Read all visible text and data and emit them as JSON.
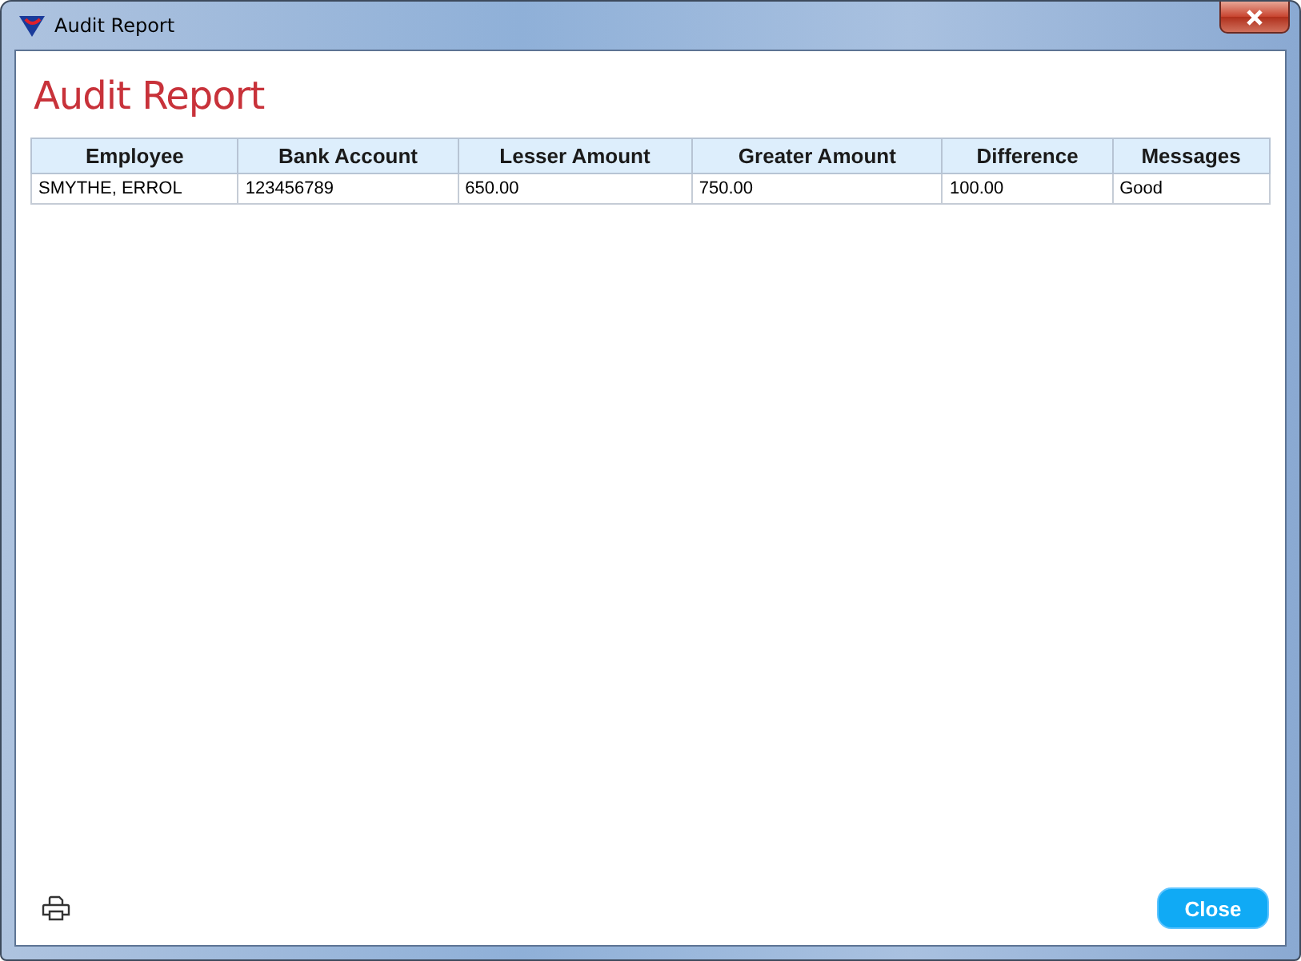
{
  "window": {
    "title": "Audit Report"
  },
  "heading": "Audit Report",
  "table": {
    "columns": [
      "Employee",
      "Bank Account",
      "Lesser Amount",
      "Greater Amount",
      "Difference",
      "Messages"
    ],
    "rows": [
      [
        "SMYTHE, ERROL",
        "123456789",
        "650.00",
        "750.00",
        "100.00",
        "Good"
      ]
    ]
  },
  "buttons": {
    "close": "Close"
  }
}
